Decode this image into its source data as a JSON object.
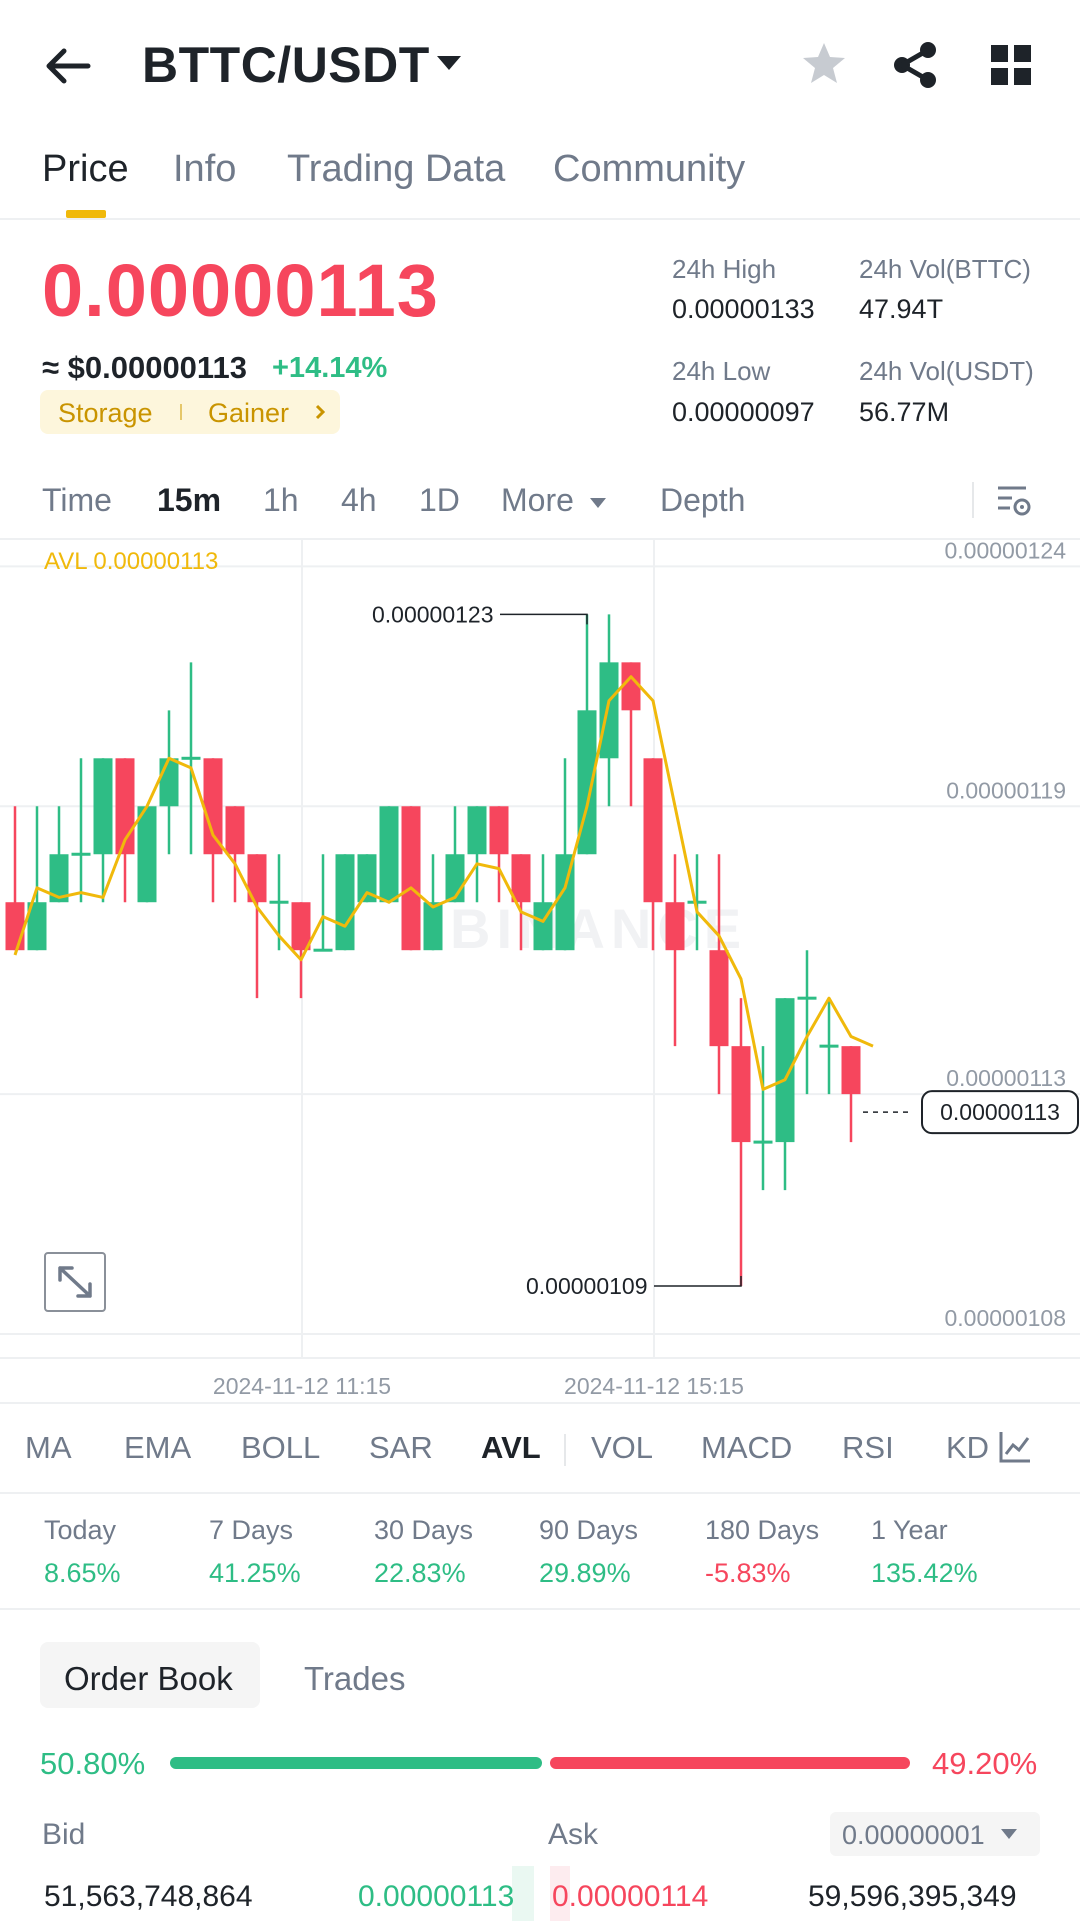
{
  "header": {
    "pair": "BTTC/USDT"
  },
  "tabs": [
    "Price",
    "Info",
    "Trading Data",
    "Community"
  ],
  "price": {
    "last": "0.00000113",
    "usd": "≈ $0.00000113",
    "change": "+14.14%",
    "tags": [
      "Storage",
      "Gainer"
    ]
  },
  "stats": {
    "high_label": "24h High",
    "high_value": "0.00000133",
    "low_label": "24h Low",
    "low_value": "0.00000097",
    "vol_base_label": "24h Vol(BTTC)",
    "vol_base_value": "47.94T",
    "vol_quote_label": "24h Vol(USDT)",
    "vol_quote_value": "56.77M"
  },
  "timeframes": {
    "items": [
      "Time",
      "15m",
      "1h",
      "4h",
      "1D",
      "More",
      "Depth"
    ],
    "active": "15m"
  },
  "chart": {
    "avl_label": "AVL 0.00000113",
    "y_labels": [
      "0.00000124",
      "0.00000119",
      "0.00000113",
      "0.00000108"
    ],
    "x_labels": [
      "2024-11-12 11:15",
      "2024-11-12 15:15"
    ],
    "high_marker": "0.00000123",
    "low_marker": "0.00000109",
    "current_price": "0.00000113",
    "watermark": "BINANCE",
    "colors": {
      "up": "#2ebd85",
      "down": "#f6465d",
      "avl": "#f0b90b"
    }
  },
  "chart_data": {
    "type": "candlestick",
    "ylim": [
      1.075e-06,
      1.2455e-06
    ],
    "y_ticks": [
      1.24e-06,
      1.19e-06,
      1.13e-06,
      1.08e-06
    ],
    "x_ticks": [
      "2024-11-12 11:15",
      "2024-11-12 15:15"
    ],
    "candles": [
      {
        "o": 1.17e-06,
        "h": 1.19e-06,
        "l": 1.16e-06,
        "c": 1.16e-06
      },
      {
        "o": 1.16e-06,
        "h": 1.19e-06,
        "l": 1.16e-06,
        "c": 1.17e-06
      },
      {
        "o": 1.17e-06,
        "h": 1.19e-06,
        "l": 1.17e-06,
        "c": 1.18e-06
      },
      {
        "o": 1.18e-06,
        "h": 1.2e-06,
        "l": 1.17e-06,
        "c": 1.18e-06
      },
      {
        "o": 1.18e-06,
        "h": 1.2e-06,
        "l": 1.17e-06,
        "c": 1.2e-06
      },
      {
        "o": 1.2e-06,
        "h": 1.2e-06,
        "l": 1.17e-06,
        "c": 1.18e-06
      },
      {
        "o": 1.17e-06,
        "h": 1.19e-06,
        "l": 1.17e-06,
        "c": 1.19e-06
      },
      {
        "o": 1.19e-06,
        "h": 1.21e-06,
        "l": 1.18e-06,
        "c": 1.2e-06
      },
      {
        "o": 1.2e-06,
        "h": 1.22e-06,
        "l": 1.18e-06,
        "c": 1.2e-06
      },
      {
        "o": 1.2e-06,
        "h": 1.2e-06,
        "l": 1.17e-06,
        "c": 1.18e-06
      },
      {
        "o": 1.19e-06,
        "h": 1.19e-06,
        "l": 1.17e-06,
        "c": 1.18e-06
      },
      {
        "o": 1.18e-06,
        "h": 1.18e-06,
        "l": 1.15e-06,
        "c": 1.17e-06
      },
      {
        "o": 1.17e-06,
        "h": 1.18e-06,
        "l": 1.16e-06,
        "c": 1.17e-06
      },
      {
        "o": 1.17e-06,
        "h": 1.17e-06,
        "l": 1.15e-06,
        "c": 1.16e-06
      },
      {
        "o": 1.16e-06,
        "h": 1.18e-06,
        "l": 1.16e-06,
        "c": 1.16e-06
      },
      {
        "o": 1.16e-06,
        "h": 1.18e-06,
        "l": 1.16e-06,
        "c": 1.18e-06
      },
      {
        "o": 1.17e-06,
        "h": 1.18e-06,
        "l": 1.17e-06,
        "c": 1.18e-06
      },
      {
        "o": 1.17e-06,
        "h": 1.19e-06,
        "l": 1.17e-06,
        "c": 1.19e-06
      },
      {
        "o": 1.19e-06,
        "h": 1.19e-06,
        "l": 1.16e-06,
        "c": 1.16e-06
      },
      {
        "o": 1.16e-06,
        "h": 1.18e-06,
        "l": 1.16e-06,
        "c": 1.17e-06
      },
      {
        "o": 1.17e-06,
        "h": 1.19e-06,
        "l": 1.17e-06,
        "c": 1.18e-06
      },
      {
        "o": 1.18e-06,
        "h": 1.19e-06,
        "l": 1.17e-06,
        "c": 1.19e-06
      },
      {
        "o": 1.19e-06,
        "h": 1.19e-06,
        "l": 1.17e-06,
        "c": 1.18e-06
      },
      {
        "o": 1.18e-06,
        "h": 1.18e-06,
        "l": 1.16e-06,
        "c": 1.17e-06
      },
      {
        "o": 1.16e-06,
        "h": 1.18e-06,
        "l": 1.16e-06,
        "c": 1.17e-06
      },
      {
        "o": 1.16e-06,
        "h": 1.2e-06,
        "l": 1.16e-06,
        "c": 1.18e-06
      },
      {
        "o": 1.18e-06,
        "h": 1.23e-06,
        "l": 1.18e-06,
        "c": 1.21e-06
      },
      {
        "o": 1.2e-06,
        "h": 1.23e-06,
        "l": 1.19e-06,
        "c": 1.22e-06
      },
      {
        "o": 1.22e-06,
        "h": 1.22e-06,
        "l": 1.19e-06,
        "c": 1.21e-06
      },
      {
        "o": 1.2e-06,
        "h": 1.2e-06,
        "l": 1.16e-06,
        "c": 1.17e-06
      },
      {
        "o": 1.17e-06,
        "h": 1.18e-06,
        "l": 1.14e-06,
        "c": 1.16e-06
      },
      {
        "o": 1.17e-06,
        "h": 1.18e-06,
        "l": 1.16e-06,
        "c": 1.17e-06
      },
      {
        "o": 1.16e-06,
        "h": 1.18e-06,
        "l": 1.13e-06,
        "c": 1.14e-06
      },
      {
        "o": 1.14e-06,
        "h": 1.15e-06,
        "l": 1.09e-06,
        "c": 1.12e-06
      },
      {
        "o": 1.12e-06,
        "h": 1.14e-06,
        "l": 1.11e-06,
        "c": 1.12e-06
      },
      {
        "o": 1.12e-06,
        "h": 1.15e-06,
        "l": 1.11e-06,
        "c": 1.15e-06
      },
      {
        "o": 1.15e-06,
        "h": 1.16e-06,
        "l": 1.13e-06,
        "c": 1.15e-06
      },
      {
        "o": 1.14e-06,
        "h": 1.15e-06,
        "l": 1.13e-06,
        "c": 1.14e-06
      },
      {
        "o": 1.14e-06,
        "h": 1.14e-06,
        "l": 1.12e-06,
        "c": 1.13e-06
      }
    ],
    "avl": [
      1.159e-06,
      1.173e-06,
      1.171e-06,
      1.172e-06,
      1.171e-06,
      1.183e-06,
      1.19e-06,
      1.2e-06,
      1.198e-06,
      1.184e-06,
      1.178e-06,
      1.169e-06,
      1.163e-06,
      1.158e-06,
      1.167e-06,
      1.165e-06,
      1.172e-06,
      1.17e-06,
      1.173e-06,
      1.169e-06,
      1.171e-06,
      1.178e-06,
      1.177e-06,
      1.168e-06,
      1.166e-06,
      1.173e-06,
      1.19e-06,
      1.212e-06,
      1.217e-06,
      1.212e-06,
      1.19e-06,
      1.168e-06,
      1.163e-06,
      1.154e-06,
      1.131e-06,
      1.133e-06,
      1.142e-06,
      1.15e-06,
      1.142e-06,
      1.14e-06
    ]
  },
  "indicators": {
    "items": [
      "MA",
      "EMA",
      "BOLL",
      "SAR",
      "AVL",
      "VOL",
      "MACD",
      "RSI",
      "KD"
    ],
    "active": "AVL"
  },
  "performance": [
    {
      "label": "Today",
      "value": "8.65%",
      "dir": "up"
    },
    {
      "label": "7 Days",
      "value": "41.25%",
      "dir": "up"
    },
    {
      "label": "30 Days",
      "value": "22.83%",
      "dir": "up"
    },
    {
      "label": "90 Days",
      "value": "29.89%",
      "dir": "up"
    },
    {
      "label": "180 Days",
      "value": "-5.83%",
      "dir": "down"
    },
    {
      "label": "1 Year",
      "value": "135.42%",
      "dir": "up"
    }
  ],
  "order_book": {
    "tabs": [
      "Order Book",
      "Trades"
    ],
    "bid_ratio": "50.80%",
    "ask_ratio": "49.20%",
    "bid_ratio_value": 50.8,
    "bid_label": "Bid",
    "ask_label": "Ask",
    "precision": "0.00000001",
    "row": {
      "bid_qty": "51,563,748,864",
      "bid_price": "0.00000113",
      "ask_price": "0.00000114",
      "ask_qty": "59,596,395,349"
    }
  }
}
